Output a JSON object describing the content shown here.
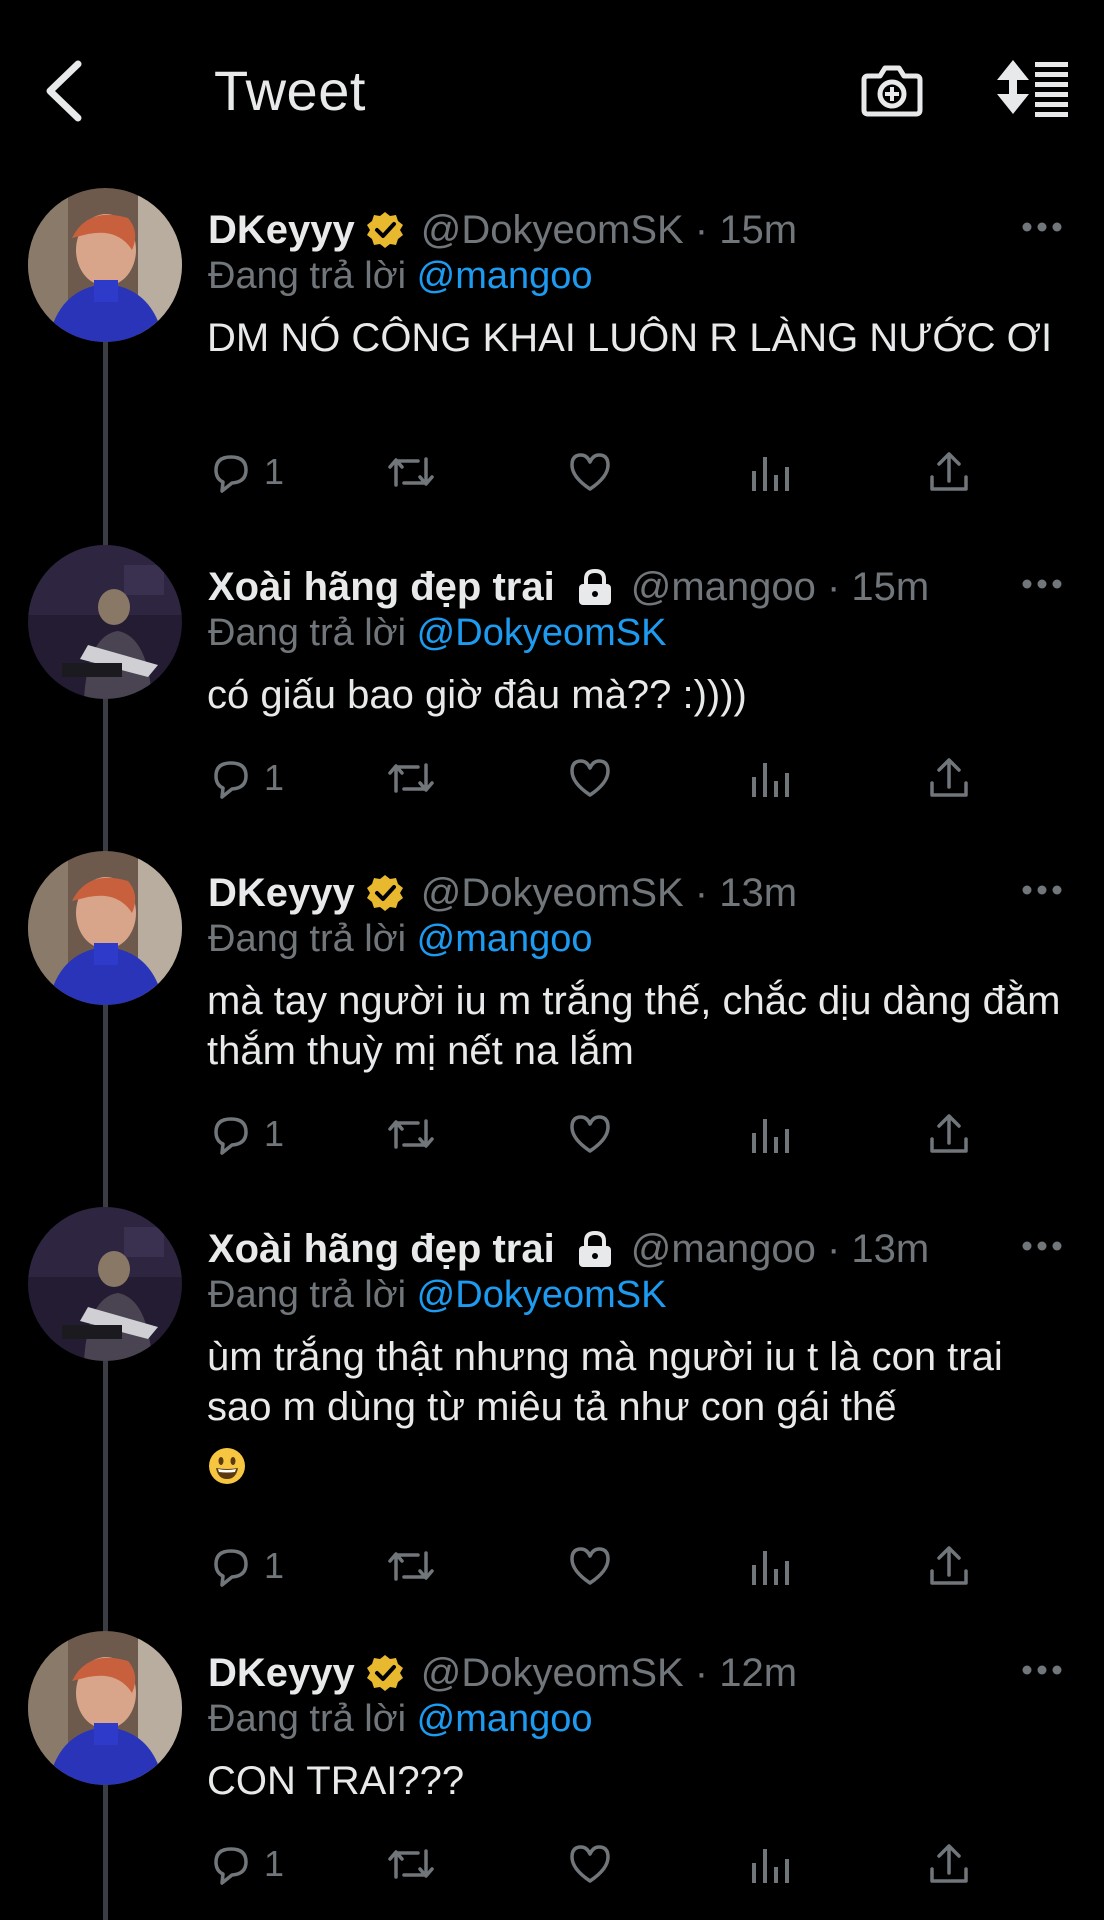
{
  "header": {
    "title": "Tweet",
    "back_icon": "chevron-left-icon",
    "camera_icon": "camera-plus-icon",
    "sort_icon": "sort-list-icon"
  },
  "colors": {
    "background": "#000000",
    "text_primary": "#e7e9ea",
    "text_secondary": "#71767b",
    "link": "#1d9bf0",
    "verified_gold": "#e8b82e",
    "thread_line": "#3a3d41"
  },
  "tweets": [
    {
      "display_name": "DKeyyy",
      "verified": true,
      "protected": false,
      "handle": "@DokyeomSK",
      "time": "15m",
      "reply_prefix": "Đang trả lời",
      "reply_to": "@mangoo",
      "text": "DM NÓ CÔNG KHAI LUÔN R LÀNG NƯỚC ƠI",
      "reply_count": "1"
    },
    {
      "display_name": "Xoài hãng đẹp trai",
      "verified": false,
      "protected": true,
      "handle": "@mangoo",
      "time": "15m",
      "reply_prefix": "Đang trả lời",
      "reply_to": "@DokyeomSK",
      "text": "có giấu bao giờ đâu mà?? :))))",
      "reply_count": "1"
    },
    {
      "display_name": "DKeyyy",
      "verified": true,
      "protected": false,
      "handle": "@DokyeomSK",
      "time": "13m",
      "reply_prefix": "Đang trả lời",
      "reply_to": "@mangoo",
      "text": "mà tay người iu m trắng thế, chắc dịu dàng đằm thắm thuỳ mị nết na lắm",
      "reply_count": "1"
    },
    {
      "display_name": "Xoài hãng đẹp trai",
      "verified": false,
      "protected": true,
      "handle": "@mangoo",
      "time": "13m",
      "reply_prefix": "Đang trả lời",
      "reply_to": "@DokyeomSK",
      "text": "ùm trắng thật nhưng mà người iu t là con trai sao m dùng từ miêu tả như con gái thế",
      "emoji": "grinning-face-emoji",
      "reply_count": "1"
    },
    {
      "display_name": "DKeyyy",
      "verified": true,
      "protected": false,
      "handle": "@DokyeomSK",
      "time": "12m",
      "reply_prefix": "Đang trả lời",
      "reply_to": "@mangoo",
      "text": "CON TRAI???",
      "reply_count": "1"
    }
  ],
  "separator": " · "
}
